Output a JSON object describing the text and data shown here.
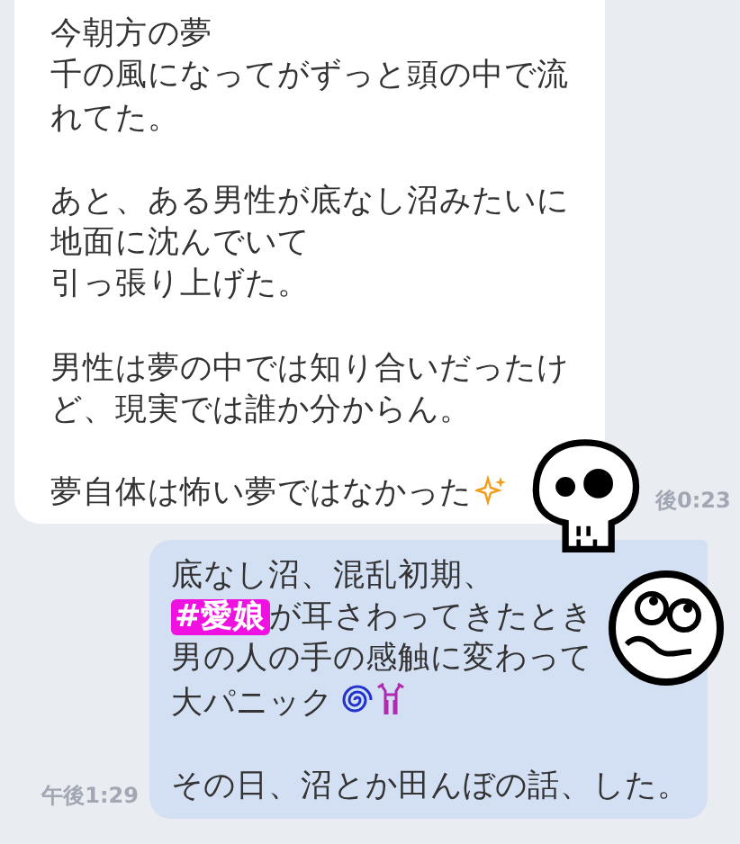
{
  "received_message": {
    "time": "後0:23",
    "paragraphs": [
      [
        [
          {
            "kind": "text",
            "text": "今朝方の夢"
          }
        ],
        [
          {
            "kind": "text",
            "text": "千の風になってがずっと頭の中で流"
          }
        ],
        [
          {
            "kind": "text",
            "text": "れてた。"
          }
        ]
      ],
      [
        [
          {
            "kind": "text",
            "text": "あと、ある男性が底なし沼みたいに"
          }
        ],
        [
          {
            "kind": "text",
            "text": "地面に沈んでいて"
          }
        ],
        [
          {
            "kind": "text",
            "text": "引っ張り上げた。"
          }
        ]
      ],
      [
        [
          {
            "kind": "text",
            "text": "男性は夢の中では知り合いだったけ"
          }
        ],
        [
          {
            "kind": "text",
            "text": "ど、現実では誰か分からん。"
          }
        ]
      ],
      [
        [
          {
            "kind": "text",
            "text": "夢自体は怖い夢ではなかった"
          },
          {
            "kind": "sparkle"
          }
        ]
      ]
    ]
  },
  "sent_message": {
    "time": "午後1:29",
    "paragraphs": [
      [
        [
          {
            "kind": "text",
            "text": "底なし沼、混乱初期、"
          }
        ],
        [
          {
            "kind": "hashtag",
            "text": "#愛娘"
          },
          {
            "kind": "text",
            "text": "が耳さわってきたとき"
          }
        ],
        [
          {
            "kind": "text",
            "text": "男の人の手の感触に変わって"
          }
        ],
        [
          {
            "kind": "text",
            "text": "大パニック"
          },
          {
            "kind": "spiral"
          },
          {
            "kind": "shock"
          }
        ]
      ],
      [
        [
          {
            "kind": "text",
            "text": "その日、沼とか田んぼの話、した。"
          }
        ]
      ]
    ]
  }
}
